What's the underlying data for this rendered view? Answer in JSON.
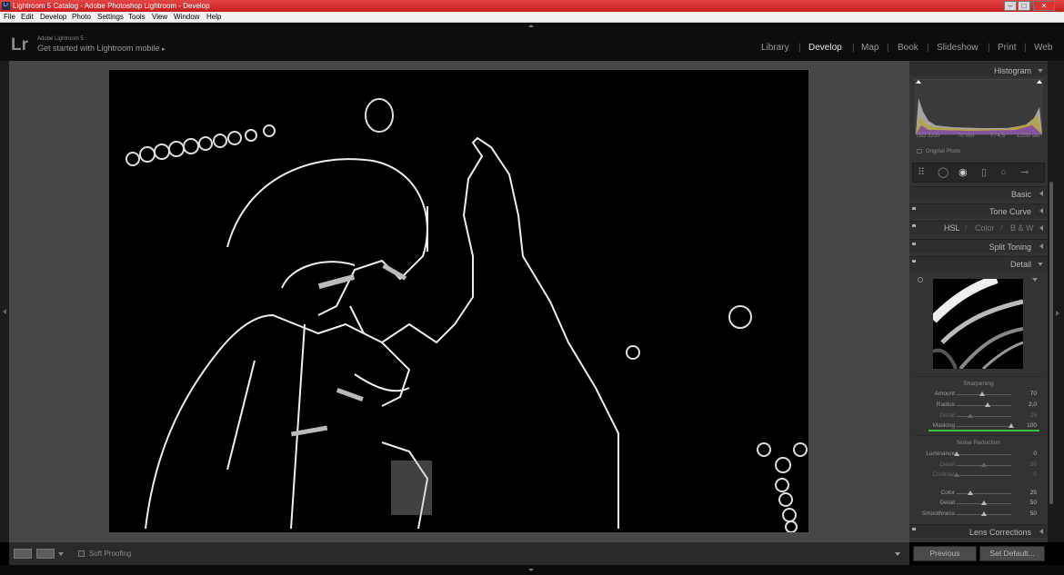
{
  "window": {
    "title": "Lightroom 5 Catalog - Adobe Photoshop Lightroom - Develop",
    "app_icon": "Lr"
  },
  "menu": [
    "File",
    "Edit",
    "Develop",
    "Photo",
    "Settings",
    "Tools",
    "View",
    "Window",
    "Help"
  ],
  "header": {
    "logo": "Lr",
    "product": "Adobe Lightroom 5",
    "tagline": "Get started with Lightroom mobile",
    "modules": [
      "Library",
      "Develop",
      "Map",
      "Book",
      "Slideshow",
      "Print",
      "Web"
    ],
    "active_module": "Develop"
  },
  "toolbar": {
    "soft_proofing": "Soft Proofing"
  },
  "right_panel": {
    "histogram": {
      "title": "Histogram",
      "iso": "ISO 3200",
      "focal": "70 mm",
      "aperture": "f / 4,5",
      "shutter": "1/200 sec",
      "original_photo": "Original Photo"
    },
    "panels": {
      "basic": "Basic",
      "tone_curve": "Tone Curve",
      "hsl": "HSL",
      "color": "Color",
      "bw": "B & W",
      "hsl_sep1": "/",
      "hsl_sep2": "/",
      "split_toning": "Split Toning",
      "detail": "Detail",
      "lens_corrections": "Lens Corrections"
    },
    "sharpening": {
      "title": "Sharpening",
      "rows": [
        {
          "label": "Amount",
          "value": "70",
          "fraction": 0.47
        },
        {
          "label": "Radius",
          "value": "2,0",
          "fraction": 0.57
        },
        {
          "label": "Detail",
          "value": "25",
          "fraction": 0.25
        },
        {
          "label": "Masking",
          "value": "100",
          "fraction": 1.0
        }
      ]
    },
    "noise_reduction": {
      "title": "Noise Reduction",
      "rows": [
        {
          "label": "Luminance",
          "value": "0",
          "fraction": 0.0
        },
        {
          "label": "Detail",
          "value": "50",
          "fraction": 0.5
        },
        {
          "label": "Contrast",
          "value": "0",
          "fraction": 0.0
        },
        {
          "label": "Color",
          "value": "25",
          "fraction": 0.25
        },
        {
          "label": "Detail",
          "value": "50",
          "fraction": 0.5
        },
        {
          "label": "Smoothness",
          "value": "50",
          "fraction": 0.5
        }
      ]
    },
    "buttons": {
      "previous": "Previous",
      "set_default": "Set Default..."
    }
  },
  "colors": {
    "title_bar": "#d32f2f",
    "accent_masking": "#3fbf3f",
    "panel_bg": "#333333",
    "canvas_bg": "#474747"
  }
}
